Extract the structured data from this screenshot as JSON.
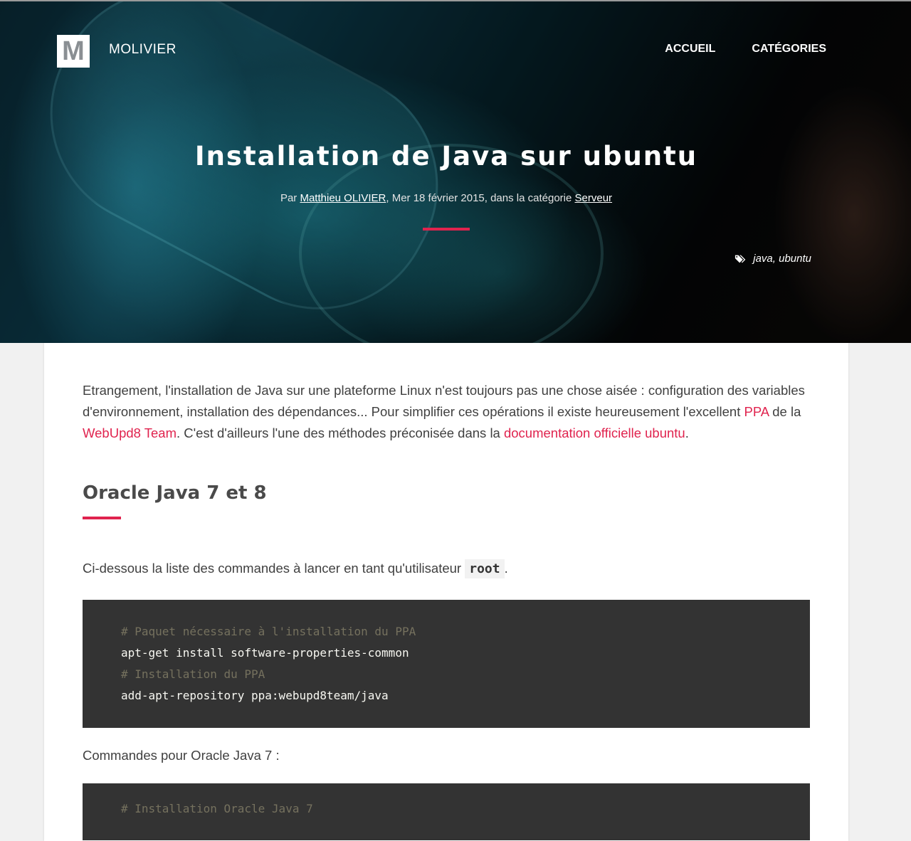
{
  "header": {
    "logo_letter": "M",
    "brand": "MOLIVIER",
    "nav": [
      "ACCUEIL",
      "CATÉGORIES"
    ]
  },
  "article": {
    "title": "Installation de Java sur ubuntu",
    "meta_prefix": "Par ",
    "author": "Matthieu OLIVIER",
    "meta_middle": ", Mer 18 février 2015, dans la catégorie ",
    "category": "Serveur",
    "tags": [
      "java",
      "ubuntu"
    ],
    "tag_separator": ", "
  },
  "content": {
    "intro_1": "Etrangement, l'installation de Java sur une plateforme Linux n'est toujours pas une chose aisée : configuration des variables d'environnement, installation des dépendances... Pour simplifier ces opérations il existe heureusement l'excellent ",
    "link_ppa": "PPA",
    "intro_2": " de la ",
    "link_webupd8": "WebUpd8 Team",
    "intro_3": ". C'est d'ailleurs l'une des méthodes préconisée dans la ",
    "link_doc": "documentation officielle ubuntu",
    "intro_4": ".",
    "section_title": "Oracle Java 7 et 8",
    "commands_intro": "Ci-dessous la liste des commandes à lancer en tant qu'utilisateur ",
    "root_code": "root",
    "commands_intro_end": ".",
    "code_block_1": [
      {
        "type": "comment",
        "text": "# Paquet nécessaire à l'installation du PPA"
      },
      {
        "type": "cmd",
        "text": "apt-get install software-properties-common"
      },
      {
        "type": "comment",
        "text": "# Installation du PPA"
      },
      {
        "type": "cmd",
        "text": "add-apt-repository ppa:webupd8team/java"
      }
    ],
    "java7_intro": "Commandes pour Oracle Java 7 :",
    "code_block_2_first": "# Installation Oracle Java 7"
  },
  "colors": {
    "accent": "#e0234e",
    "code_bg": "#333333",
    "code_comment": "#75715e"
  }
}
